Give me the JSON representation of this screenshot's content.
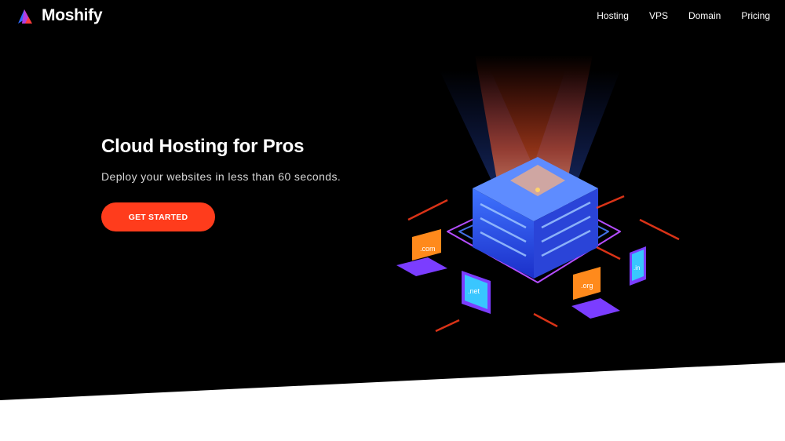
{
  "brand": {
    "name": "Moshify"
  },
  "nav": {
    "items": [
      {
        "label": "Hosting"
      },
      {
        "label": "VPS"
      },
      {
        "label": "Domain"
      },
      {
        "label": "Pricing"
      }
    ]
  },
  "hero": {
    "title": "Cloud Hosting for Pros",
    "subtitle": "Deploy your websites in less than 60 seconds.",
    "cta_label": "GET STARTED"
  },
  "illustration": {
    "domains": [
      ".com",
      ".net",
      ".org",
      ".in"
    ]
  },
  "colors": {
    "background": "#000000",
    "accent": "#ff3c1c",
    "server_blue": "#2f5bff",
    "device_purple": "#7b3dff",
    "ring_purple": "#b44dff"
  }
}
